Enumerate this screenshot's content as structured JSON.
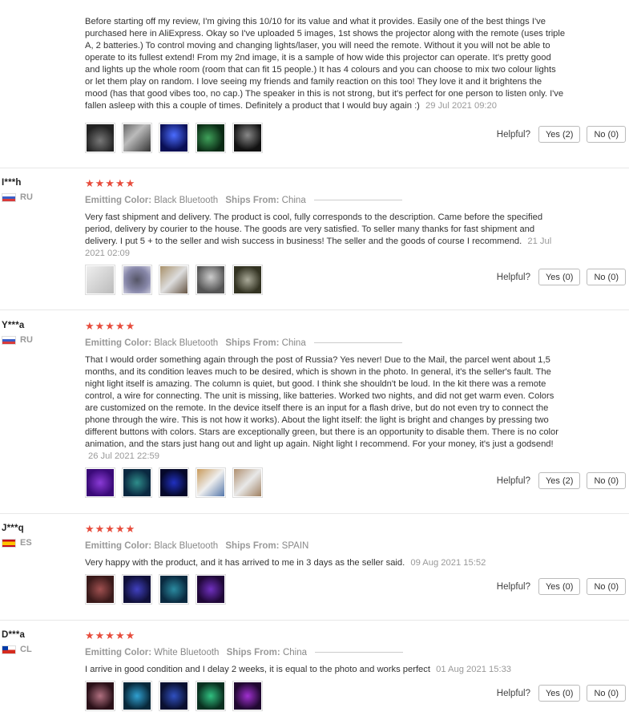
{
  "reviews": [
    {
      "user": "",
      "country": "",
      "text": "Before starting off my review, I'm giving this 10/10 for its value and what it provides. Easily one of the best things I've purchased here in AliExpress. Okay so I've uploaded 5 images, 1st shows the projector along with the remote (uses triple A, 2 batteries.) To control moving and changing lights/laser, you will need the remote. Without it you will not be able to operate to its fullest extend! From my 2nd image, it is a sample of how wide this projector can operate. It's pretty good and lights up the whole room (room that can fit 15 people.) It has 4 colours and you can choose to mix two colour lights or let them play on random. I love seeing my friends and family reaction on this too! They love it and it brightens the mood (has that good vibes too, no cap.) The speaker in this is not strong, but it's perfect for one person to listen only. I've fallen asleep with this a couple of times. Definitely a product that I would buy again :)",
      "date": "29 Jul 2021 09:20",
      "helpful_label": "Helpful?",
      "yes": "Yes (2)",
      "no": "No (0)"
    },
    {
      "user": "I***h",
      "country": "RU",
      "stars": "★★★★★",
      "color_label": "Emitting Color:",
      "color": "Black Bluetooth",
      "ships_label": "Ships From:",
      "ships": "China",
      "text": "Very fast shipment and delivery. The product is cool, fully corresponds to the description. Came before the specified period, delivery by courier to the house. The goods are very satisfied. To seller many thanks for fast shipment and delivery. I put 5 + to the seller and wish success in business! The seller and the goods of course I recommend.",
      "date": "21 Jul 2021 02:09",
      "helpful_label": "Helpful?",
      "yes": "Yes (0)",
      "no": "No (0)"
    },
    {
      "user": "Y***a",
      "country": "RU",
      "stars": "★★★★★",
      "color_label": "Emitting Color:",
      "color": "Black Bluetooth",
      "ships_label": "Ships From:",
      "ships": "China",
      "text": "That I would order something again through the post of Russia? Yes never! Due to the Mail, the parcel went about 1,5 months, and its condition leaves much to be desired, which is shown in the photo. In general, it's the seller's fault. The night light itself is amazing. The column is quiet, but good. I think she shouldn't be loud. In the kit there was a remote control, a wire for connecting. The unit is missing, like batteries. Worked two nights, and did not get warm even. Colors are customized on the remote. In the device itself there is an input for a flash drive, but do not even try to connect the phone through the wire. This is not how it works). About the light itself: the light is bright and changes by pressing two different buttons with colors. Stars are exceptionally green, but there is an opportunity to disable them. There is no color animation, and the stars just hang out and light up again. Night light I recommend. For your money, it's just a godsend!",
      "date": "26 Jul 2021 22:59",
      "helpful_label": "Helpful?",
      "yes": "Yes (2)",
      "no": "No (0)"
    },
    {
      "user": "J***q",
      "country": "ES",
      "stars": "★★★★★",
      "color_label": "Emitting Color:",
      "color": "Black Bluetooth",
      "ships_label": "Ships From:",
      "ships": "SPAIN",
      "text": "Very happy with the product, and it has arrived to me in 3 days as the seller said.",
      "date": "09 Aug 2021 15:52",
      "helpful_label": "Helpful?",
      "yes": "Yes (0)",
      "no": "No (0)"
    },
    {
      "user": "D***a",
      "country": "CL",
      "stars": "★★★★★",
      "color_label": "Emitting Color:",
      "color": "White Bluetooth",
      "ships_label": "Ships From:",
      "ships": "China",
      "text": "I arrive in good condition and I delay 2 weeks, it is equal to the photo and works perfect",
      "date": "01 Aug 2021 15:33",
      "helpful_label": "Helpful?",
      "yes": "Yes (0)",
      "no": "No (0)"
    }
  ]
}
